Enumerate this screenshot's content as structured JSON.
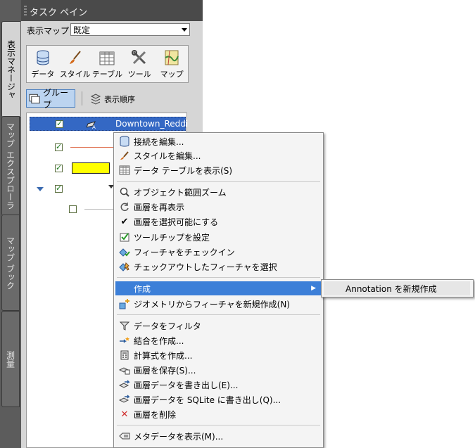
{
  "panel": {
    "title": "タスク ペイン",
    "vertical_tabs": [
      "表示マネージャ",
      "マップ エクスプローラ",
      "マップ ブック",
      "測量"
    ],
    "map_label": "表示マップ",
    "map_value": "既定",
    "tools": [
      {
        "label": "データ",
        "icon": "database-icon"
      },
      {
        "label": "スタイル",
        "icon": "brush-icon"
      },
      {
        "label": "テーブル",
        "icon": "table-icon"
      },
      {
        "label": "ツール",
        "icon": "tools-icon"
      },
      {
        "label": "マップ",
        "icon": "map-icon"
      }
    ],
    "group_button": "グループ",
    "order_button": "表示順序",
    "layers": [
      {
        "name": "Downtown_Reddi",
        "checked": true,
        "selected": true
      },
      {
        "name": "",
        "checked": true
      },
      {
        "name": "",
        "checked": true,
        "swatch": "#ffff00"
      },
      {
        "name": "",
        "checked": true,
        "expanded": true
      },
      {
        "name": "",
        "checked": false
      }
    ]
  },
  "context_menu": {
    "items": [
      {
        "label": "接続を編集...",
        "icon": "database-icon"
      },
      {
        "label": "スタイルを編集...",
        "icon": "brush-icon"
      },
      {
        "label": "データ テーブルを表示(S)",
        "icon": "table-icon"
      },
      {
        "label": "オブジェクト範囲ズーム",
        "icon": "zoom-extents-icon"
      },
      {
        "label": "画層を再表示",
        "icon": "refresh-icon"
      },
      {
        "label": "画層を選択可能にする",
        "icon": "checkmark-icon"
      },
      {
        "label": "ツールチップを設定",
        "icon": "tooltip-icon"
      },
      {
        "label": "フィーチャをチェックイン",
        "icon": "checkin-icon"
      },
      {
        "label": "チェックアウトしたフィーチャを選択",
        "icon": "checkout-select-icon"
      },
      {
        "label": "作成",
        "icon": "",
        "submenu": true
      },
      {
        "label": "ジオメトリからフィーチャを新規作成(N)",
        "icon": "geometry-feature-icon"
      },
      {
        "label": "データをフィルタ",
        "icon": "filter-icon"
      },
      {
        "label": "結合を作成...",
        "icon": "join-icon"
      },
      {
        "label": "計算式を作成...",
        "icon": "calculator-icon"
      },
      {
        "label": "画層を保存(S)...",
        "icon": "save-layer-icon"
      },
      {
        "label": "画層データを書き出し(E)...",
        "icon": "export-icon"
      },
      {
        "label": "画層データを SQLite に書き出し(Q)...",
        "icon": "export-sqlite-icon"
      },
      {
        "label": "画層を削除",
        "icon": "delete-icon"
      },
      {
        "label": "メタデータを表示(M)...",
        "icon": "metadata-icon"
      }
    ],
    "submenu_item": "Annotation を新規作成"
  }
}
